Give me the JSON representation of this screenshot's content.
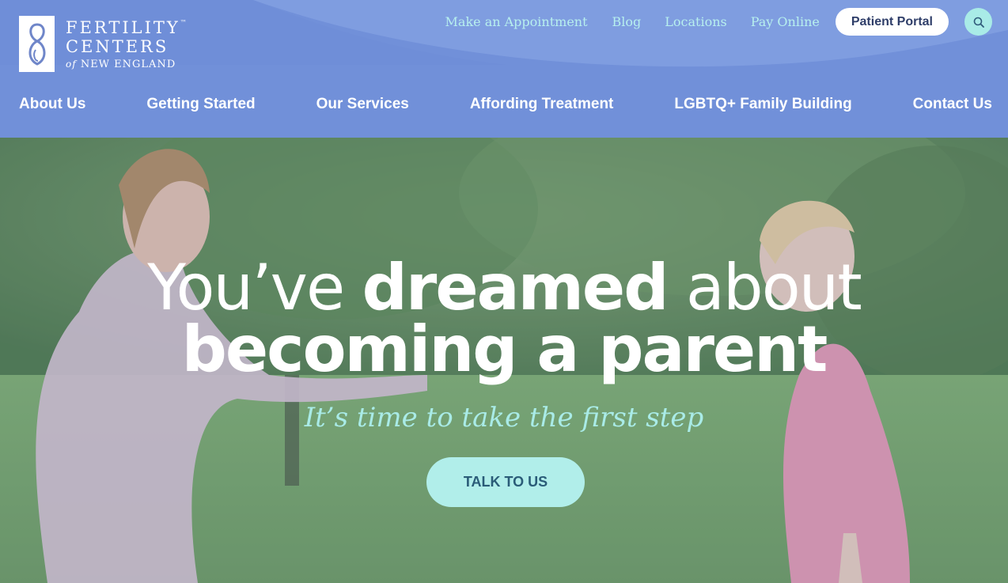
{
  "logo": {
    "line1": "FERTILITY",
    "tm": "™",
    "line2": "CENTERS",
    "of": "of",
    "line3": "NEW ENGLAND"
  },
  "utility_nav": {
    "appointment": "Make an Appointment",
    "blog": "Blog",
    "locations": "Locations",
    "pay_online": "Pay Online",
    "patient_portal": "Patient Portal",
    "search_icon": "search-icon"
  },
  "main_nav": [
    {
      "label": "About Us"
    },
    {
      "label": "Getting Started"
    },
    {
      "label": "Our Services"
    },
    {
      "label": "Affording Treatment"
    },
    {
      "label": "LGBTQ+ Family Building"
    },
    {
      "label": "Contact Us"
    }
  ],
  "hero": {
    "headline_part1": "You’ve ",
    "headline_part2": "dreamed",
    "headline_part3": " about",
    "headline_line2": "becoming a parent",
    "tagline": "It’s time to take the first step",
    "cta": "TALK TO US"
  },
  "colors": {
    "header_bg": "#7190d9",
    "accent_teal": "#a9ebe7",
    "portal_text": "#2f3e69"
  }
}
